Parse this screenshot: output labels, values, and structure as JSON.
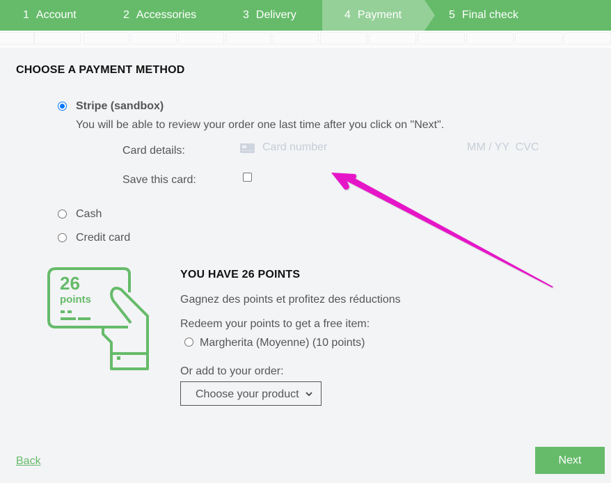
{
  "steps": [
    {
      "num": "1",
      "label": "Account",
      "active": false
    },
    {
      "num": "2",
      "label": "Accessories",
      "active": false
    },
    {
      "num": "3",
      "label": "Delivery",
      "active": false
    },
    {
      "num": "4",
      "label": "Payment",
      "active": true
    },
    {
      "num": "5",
      "label": "Final check",
      "active": false
    }
  ],
  "payment": {
    "title": "CHOOSE A PAYMENT METHOD",
    "methods": [
      {
        "label": "Stripe (sandbox)",
        "selected": true,
        "description": "You will be able to review your order one last time after you click on \"Next\"."
      },
      {
        "label": "Cash",
        "selected": false
      },
      {
        "label": "Credit card",
        "selected": false
      }
    ],
    "card_details_label": "Card details:",
    "card_number_placeholder": "Card number",
    "card_expiry_cvc_placeholder": "MM / YY  CVC",
    "save_card_label": "Save this card:",
    "save_card_checked": false
  },
  "loyalty": {
    "icon_points_value": "26",
    "icon_points_word": "points",
    "title": "YOU HAVE 26 POINTS",
    "subtitle": "Gagnez des points et profitez des réductions",
    "redeem_label": "Redeem your points to get a free item:",
    "redeem_options": [
      {
        "label": "Margherita (Moyenne) (10 points)",
        "selected": false
      }
    ],
    "add_label": "Or add to your order:",
    "product_select_value": "Choose your product"
  },
  "footer": {
    "back_label": "Back",
    "next_label": "Next"
  },
  "colors": {
    "brand_green": "#66bb6a",
    "active_step": "#95d098",
    "annotation_arrow": "#e619c8",
    "radio_selected": "#0075ff"
  }
}
